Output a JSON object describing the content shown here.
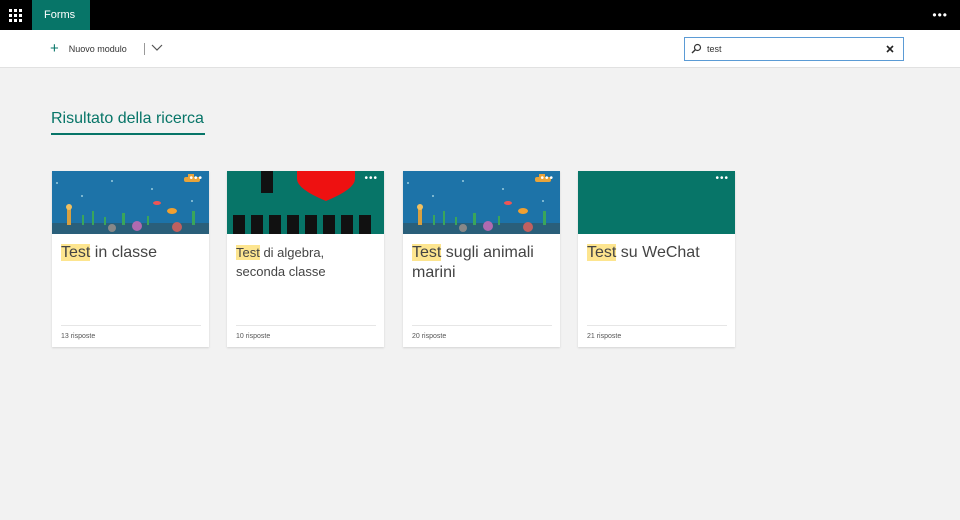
{
  "app": {
    "name": "Forms"
  },
  "toolbar": {
    "new_form_label": "Nuovo modulo"
  },
  "search": {
    "value": "test",
    "placeholder": ""
  },
  "results": {
    "title": "Risultato della ricerca",
    "cards": [
      {
        "highlight": "Test",
        "rest": " in classe",
        "responses": "13 risposte",
        "theme": "underwater"
      },
      {
        "highlight": "Test",
        "rest": " di algebra, seconda classe",
        "responses": "10 risposte",
        "theme": "algebra"
      },
      {
        "highlight": "Test",
        "rest": " sugli animali marini",
        "responses": "20 risposte",
        "theme": "underwater"
      },
      {
        "highlight": "Test",
        "rest": " su WeChat",
        "responses": "21 risposte",
        "theme": "solid-teal"
      }
    ]
  },
  "colors": {
    "brand": "#077568",
    "accent": "#077568",
    "highlight": "#fde58f",
    "search_border": "#5b9bd5"
  }
}
